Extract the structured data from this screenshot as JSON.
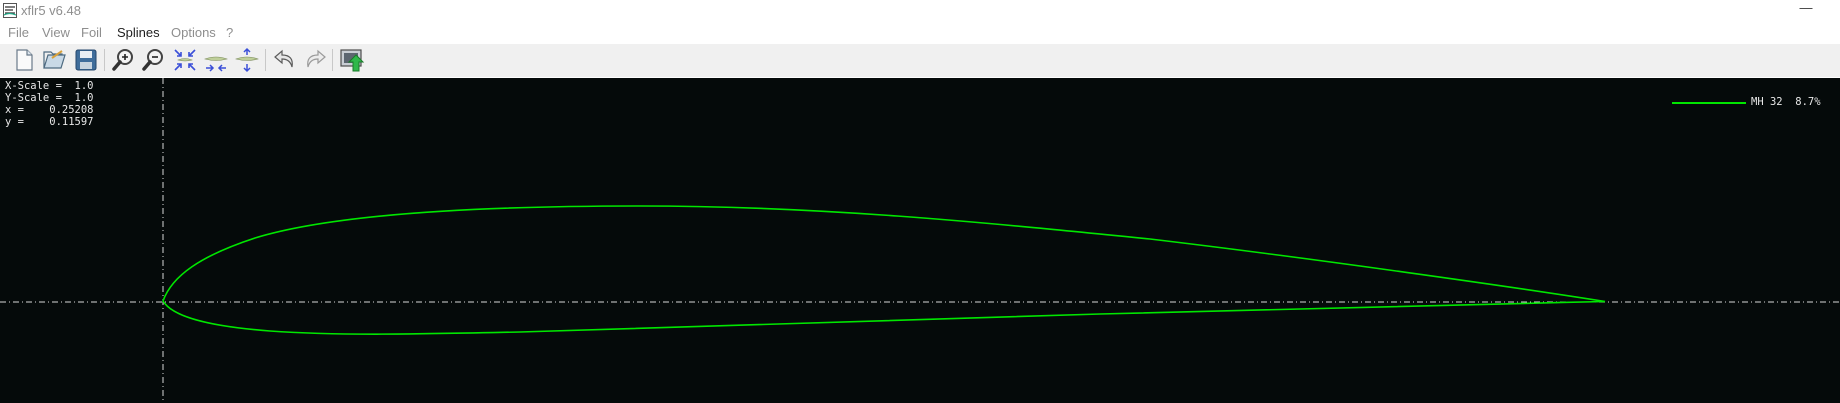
{
  "window": {
    "title": "xflr5 v6.48",
    "minimize_glyph": "—"
  },
  "menu": {
    "items": [
      {
        "label": "File",
        "enabled": false
      },
      {
        "label": "View",
        "enabled": false
      },
      {
        "label": "Foil",
        "enabled": false
      },
      {
        "label": "Splines",
        "enabled": true
      },
      {
        "label": "Options",
        "enabled": false
      },
      {
        "label": "?",
        "enabled": false
      }
    ]
  },
  "toolbar": {
    "buttons": [
      {
        "name": "new-document-icon"
      },
      {
        "name": "open-folder-icon"
      },
      {
        "name": "save-disk-icon"
      },
      {
        "name": "zoom-in-icon"
      },
      {
        "name": "zoom-out-icon"
      },
      {
        "name": "reset-scale-icon"
      },
      {
        "name": "x-scale-icon"
      },
      {
        "name": "y-scale-icon"
      },
      {
        "name": "undo-icon"
      },
      {
        "name": "redo-icon"
      },
      {
        "name": "export-image-icon"
      }
    ]
  },
  "plot": {
    "x_scale": "X-Scale =  1.0",
    "y_scale": "Y-Scale =  1.0",
    "x_readout": "x =    0.25208",
    "y_readout": "y =    0.11597",
    "background": "#050a0a",
    "curve_color": "#00e600",
    "axis_color": "#d8d8d8"
  },
  "legend": {
    "label": "MH 32  8.7%"
  }
}
